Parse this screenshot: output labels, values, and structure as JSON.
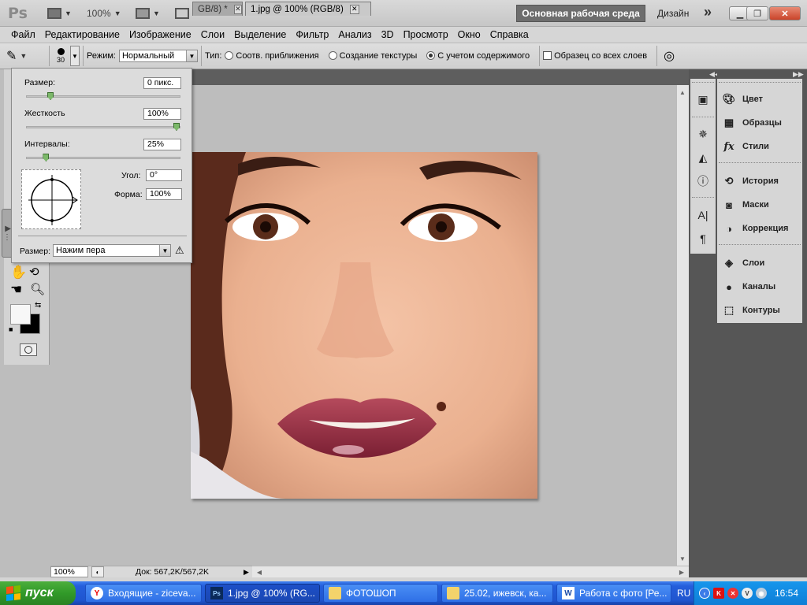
{
  "app": {
    "logo": "Ps",
    "zoom_preset": "100%",
    "workspace": "Основная рабочая среда",
    "design": "Дизайн"
  },
  "menu": [
    "Файл",
    "Редактирование",
    "Изображение",
    "Слои",
    "Выделение",
    "Фильтр",
    "Анализ",
    "3D",
    "Просмотр",
    "Окно",
    "Справка"
  ],
  "options": {
    "brush_size": "30",
    "mode_label": "Режим:",
    "mode_value": "Нормальный",
    "type_label": "Тип:",
    "type_options": [
      "Соотв. приближения",
      "Создание текстуры",
      "С учетом содержимого"
    ],
    "type_selected": "С учетом содержимого",
    "sample_all_layers": "Образец со всех слоев"
  },
  "brush_popup": {
    "size_label": "Размер:",
    "size_value": "0 пикс.",
    "size_fraction": 0.14,
    "hardness_label": "Жесткость",
    "hardness_value": "100%",
    "hardness_fraction": 1.0,
    "spacing_label": "Интервалы:",
    "spacing_value": "25%",
    "spacing_fraction": 0.11,
    "angle_label": "Угол:",
    "angle_value": "0°",
    "roundness_label": "Форма:",
    "roundness_value": "100%",
    "pressure_label": "Размер:",
    "pressure_value": "Нажим пера"
  },
  "tabs": [
    {
      "label": "GB/8) *"
    },
    {
      "label": "1.jpg @ 100% (RGB/8)"
    }
  ],
  "status": {
    "zoom": "100%",
    "doc": "Док: 567,2K/567,2K"
  },
  "panels": [
    {
      "icon": "palette-icon",
      "label": "Цвет"
    },
    {
      "icon": "swatches-icon",
      "label": "Образцы"
    },
    {
      "icon": "fx-icon",
      "label": "Стили"
    },
    {
      "icon": "history-icon",
      "label": "История"
    },
    {
      "icon": "mask-icon",
      "label": "Маски"
    },
    {
      "icon": "adjustment-icon",
      "label": "Коррекция"
    },
    {
      "icon": "layers-icon",
      "label": "Слои"
    },
    {
      "icon": "channels-icon",
      "label": "Каналы"
    },
    {
      "icon": "paths-icon",
      "label": "Контуры"
    }
  ],
  "taskbar": {
    "start": "пуск",
    "items": [
      {
        "label": "Входящие - ziceva...",
        "icon": "Y"
      },
      {
        "label": "1.jpg @ 100% (RG...",
        "icon": "Ps"
      },
      {
        "label": "ФОТОШОП",
        "icon": "folder"
      },
      {
        "label": "25.02, ижевск, ка...",
        "icon": "folder"
      },
      {
        "label": "Работа с фото [Ре...",
        "icon": "W"
      }
    ],
    "lang": "RU",
    "clock": "16:54"
  }
}
